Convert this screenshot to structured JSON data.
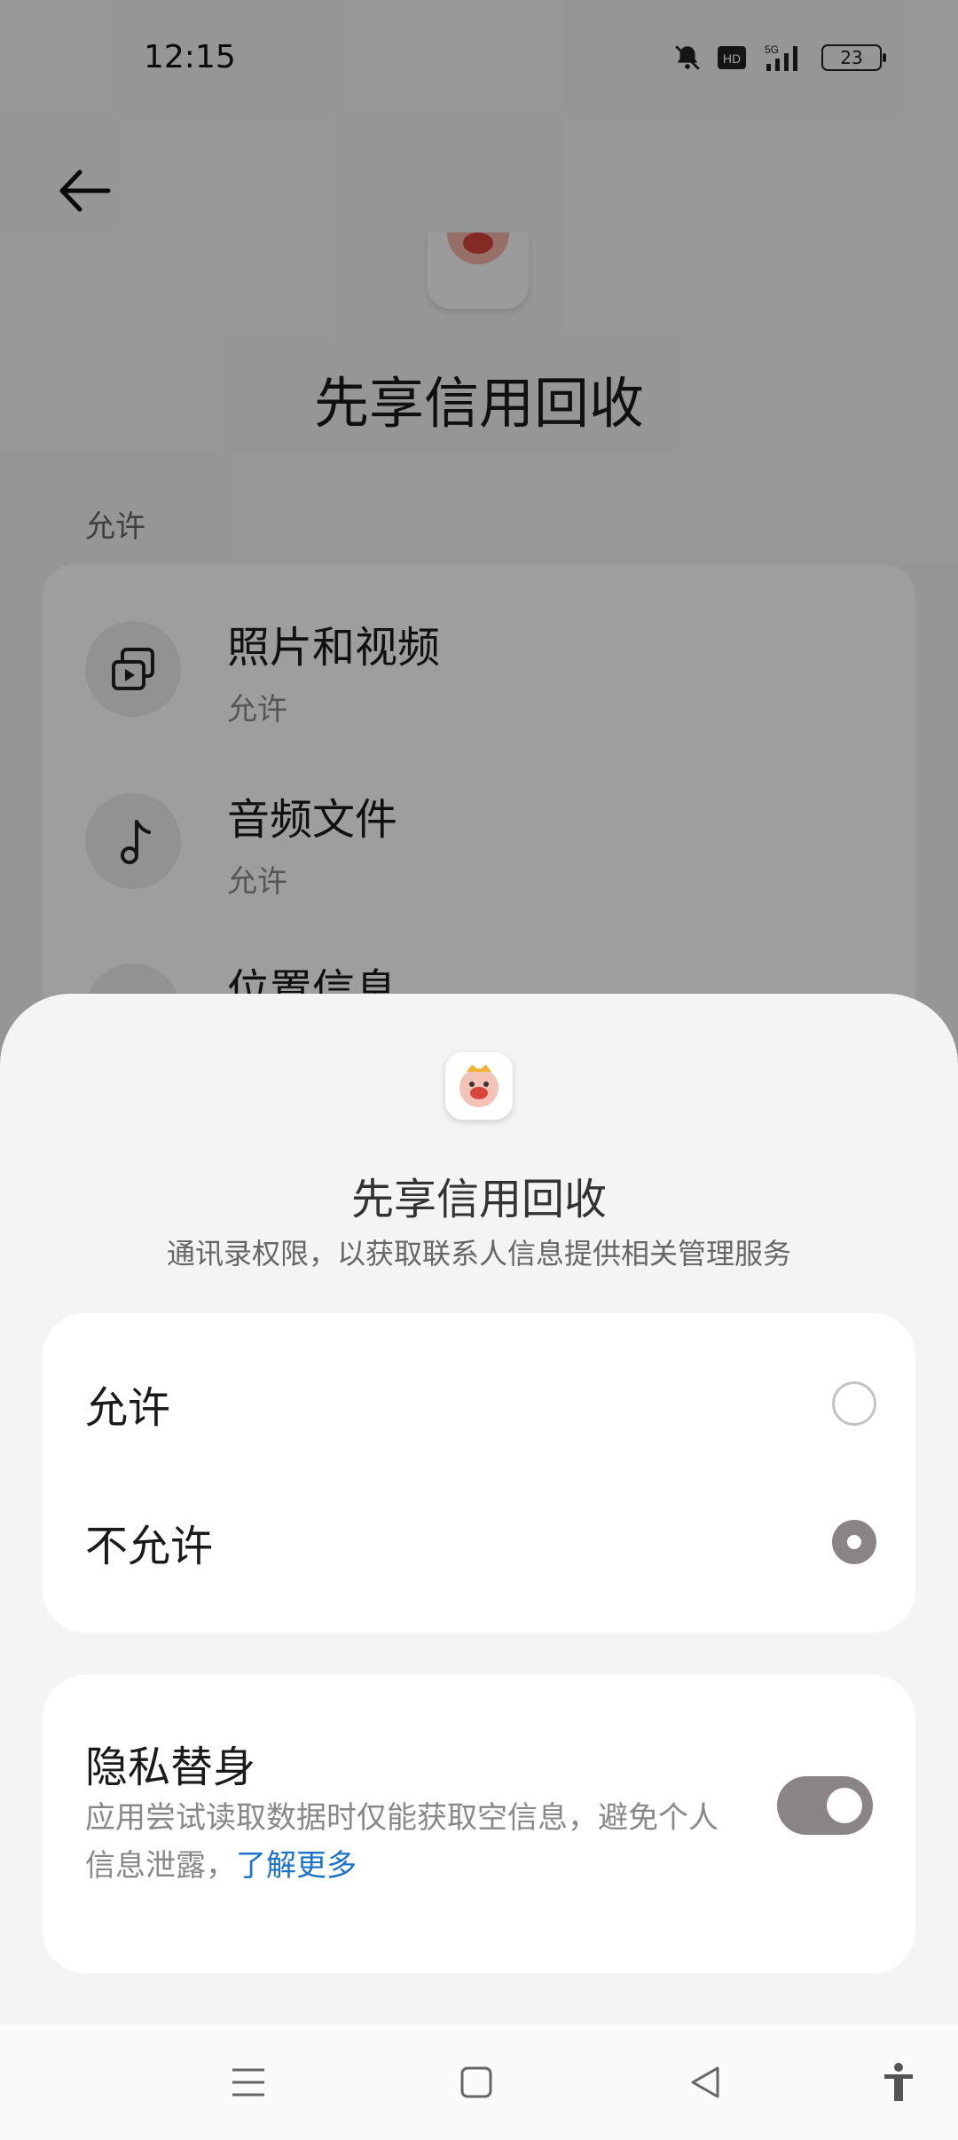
{
  "status_bar": {
    "time": "12:15",
    "network": "5G",
    "battery": "23",
    "icons": [
      "mute-bell-icon",
      "hd-icon",
      "signal-5g-icon",
      "battery-icon"
    ]
  },
  "background": {
    "back_icon": "arrow-left-icon",
    "app_name": "先享信用回收",
    "section_label": "允许",
    "permissions": [
      {
        "title": "照片和视频",
        "status": "允许",
        "icon": "photo-video-icon"
      },
      {
        "title": "音频文件",
        "status": "允许",
        "icon": "music-note-icon"
      },
      {
        "title": "位置信息",
        "icon": "location-icon"
      }
    ]
  },
  "sheet": {
    "app_name": "先享信用回收",
    "description": "通讯录权限，以获取联系人信息提供相关管理服务",
    "options": [
      {
        "label": "允许",
        "selected": false
      },
      {
        "label": "不允许",
        "selected": true
      }
    ],
    "privacy": {
      "title": "隐私替身",
      "description": "应用尝试读取数据时仅能获取空信息，避免个人信息泄露，",
      "link": "了解更多",
      "enabled": true
    }
  },
  "nav_bar": {
    "icons": [
      "menu-icon",
      "home-square-icon",
      "back-triangle-icon",
      "accessibility-icon"
    ]
  },
  "colors": {
    "accent": "#8a8487",
    "link": "#1a73c8",
    "overlay": "rgba(0,0,0,0.38)"
  }
}
